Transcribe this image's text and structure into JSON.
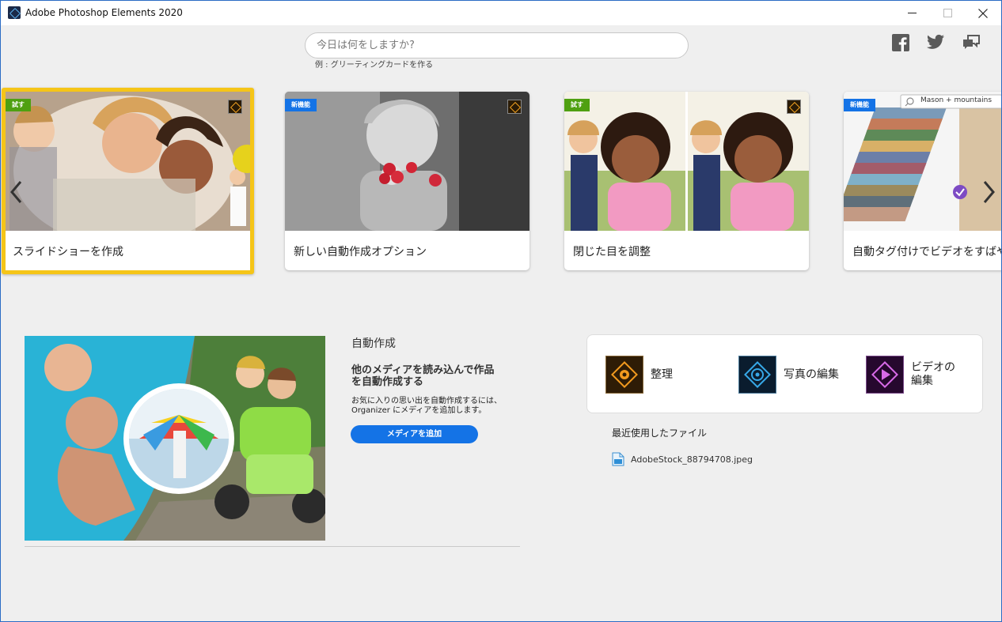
{
  "window": {
    "title": "Adobe Photoshop Elements 2020",
    "minimize_glyph": "—",
    "maximize_glyph": "☐",
    "close_glyph": "✕"
  },
  "search": {
    "placeholder": "今日は何をしますか?",
    "value": "",
    "hint": "例 : グリーティングカードを作る"
  },
  "social": [
    "facebook-icon",
    "twitter-icon",
    "feedback-icon"
  ],
  "carousel": {
    "cards": [
      {
        "badge": "試す",
        "badge_type": "try",
        "label": "スライドショーを作成",
        "selected": true
      },
      {
        "badge": "新機能",
        "badge_type": "new",
        "label": "新しい自動作成オプション",
        "selected": false
      },
      {
        "badge": "試す",
        "badge_type": "try",
        "label": "閉じた目を調整",
        "selected": false
      },
      {
        "badge": "新機能",
        "badge_type": "new",
        "label": "自動タグ付けでビデオをすばやく検",
        "selected": false,
        "search_tag": "Mason + mountains"
      }
    ]
  },
  "auto_create": {
    "title": "自動作成",
    "headline": "他のメディアを読み込んで作品を自動作成する",
    "description": "お気に入りの思い出を自動作成するには、Organizer にメディアを追加します。",
    "button": "メディアを追加"
  },
  "launcher": {
    "items": [
      {
        "label": "整理",
        "icon": "organizer-icon"
      },
      {
        "label": "写真の編集",
        "icon": "photo-editor-icon"
      },
      {
        "label": "ビデオの編集",
        "icon": "video-editor-icon"
      }
    ]
  },
  "recent": {
    "title": "最近使用したファイル",
    "files": [
      "AdobeStock_88794708.jpeg"
    ]
  },
  "colors": {
    "accent_blue": "#1473e6",
    "try_green": "#4fa011",
    "selection_yellow": "#f5c518",
    "window_border": "#2b6cc4"
  }
}
